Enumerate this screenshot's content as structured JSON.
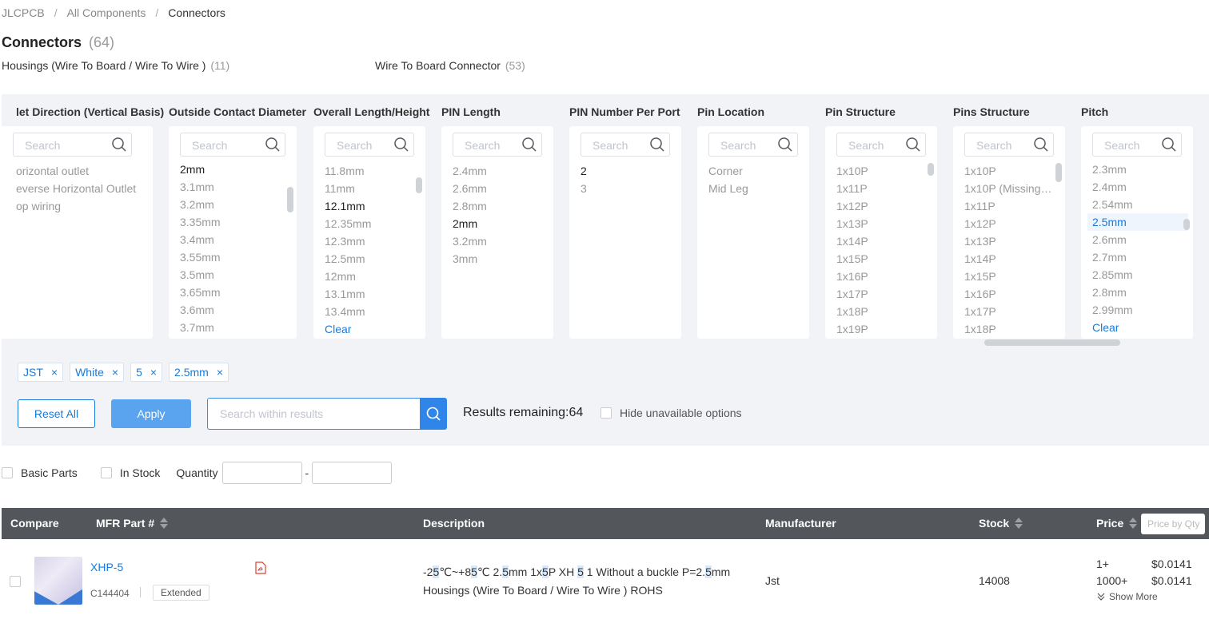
{
  "breadcrumb": {
    "root": "JLCPCB",
    "middle": "All Components",
    "current": "Connectors"
  },
  "page": {
    "title": "Connectors",
    "count": "(64)"
  },
  "subcategories": [
    {
      "label": "Housings (Wire To Board / Wire To Wire )",
      "count": "(11)"
    },
    {
      "label": "Wire To Board Connector",
      "count": "(53)"
    }
  ],
  "filters": [
    {
      "title": "let Direction (Vertical Basis)",
      "placeholder": "Search",
      "options": [
        "orizontal outlet",
        "everse Horizontal Outlet",
        "op wiring"
      ]
    },
    {
      "title": "Outside Contact Diameter",
      "placeholder": "Search",
      "options": [
        "2mm",
        "3.1mm",
        "3.2mm",
        "3.35mm",
        "3.4mm",
        "3.55mm",
        "3.5mm",
        "3.65mm",
        "3.6mm",
        "3.7mm"
      ]
    },
    {
      "title": "Overall Length/Height",
      "placeholder": "Search",
      "options": [
        "11.8mm",
        "11mm",
        "12.1mm",
        "12.35mm",
        "12.3mm",
        "12.5mm",
        "12mm",
        "13.1mm",
        "13.4mm"
      ],
      "clear": "Clear"
    },
    {
      "title": "PIN Length",
      "placeholder": "Search",
      "options": [
        "2.4mm",
        "2.6mm",
        "2.8mm",
        "2mm",
        "3.2mm",
        "3mm"
      ]
    },
    {
      "title": "PIN Number Per Port",
      "placeholder": "Search",
      "options": [
        "2",
        "3"
      ]
    },
    {
      "title": "Pin Location",
      "placeholder": "Search",
      "options": [
        "Corner",
        "Mid Leg"
      ]
    },
    {
      "title": "Pin Structure",
      "placeholder": "Search",
      "options": [
        "1x10P",
        "1x11P",
        "1x12P",
        "1x13P",
        "1x14P",
        "1x15P",
        "1x16P",
        "1x17P",
        "1x18P",
        "1x19P"
      ]
    },
    {
      "title": "Pins Structure",
      "placeholder": "Search",
      "options": [
        "1x10P",
        "1x10P (Missing Pin)",
        "1x11P",
        "1x12P",
        "1x13P",
        "1x14P",
        "1x15P",
        "1x16P",
        "1x17P",
        "1x18P"
      ]
    },
    {
      "title": "Pitch",
      "placeholder": "Search",
      "options": [
        "2.3mm",
        "2.4mm",
        "2.54mm",
        "2.5mm",
        "2.6mm",
        "2.7mm",
        "2.85mm",
        "2.8mm",
        "2.99mm"
      ],
      "clear": "Clear"
    }
  ],
  "selected_tags": [
    "JST",
    "White",
    "5",
    "2.5mm"
  ],
  "actions": {
    "reset": "Reset All",
    "apply": "Apply",
    "search_placeholder": "Search within results",
    "results_remaining": "Results remaining:64",
    "hide_unavailable": "Hide unavailable options"
  },
  "options": {
    "basic_parts": "Basic Parts",
    "in_stock": "In Stock",
    "quantity": "Quantity",
    "dash": "-"
  },
  "table": {
    "headers": {
      "compare": "Compare",
      "mfr_part": "MFR Part #",
      "description": "Description",
      "manufacturer": "Manufacturer",
      "stock": "Stock",
      "price": "Price",
      "price_by_qty": "Price by Qty"
    },
    "rows": [
      {
        "part": "XHP-5",
        "code": "C144404",
        "badge": "Extended",
        "description_line2": "Housings (Wire To Board / Wire To Wire ) ROHS",
        "manufacturer": "Jst",
        "stock": "14008",
        "prices": [
          {
            "qty": "1+",
            "price": "$0.0141"
          },
          {
            "qty": "1000+",
            "price": "$0.0141"
          }
        ],
        "show_more": "Show More"
      }
    ]
  }
}
